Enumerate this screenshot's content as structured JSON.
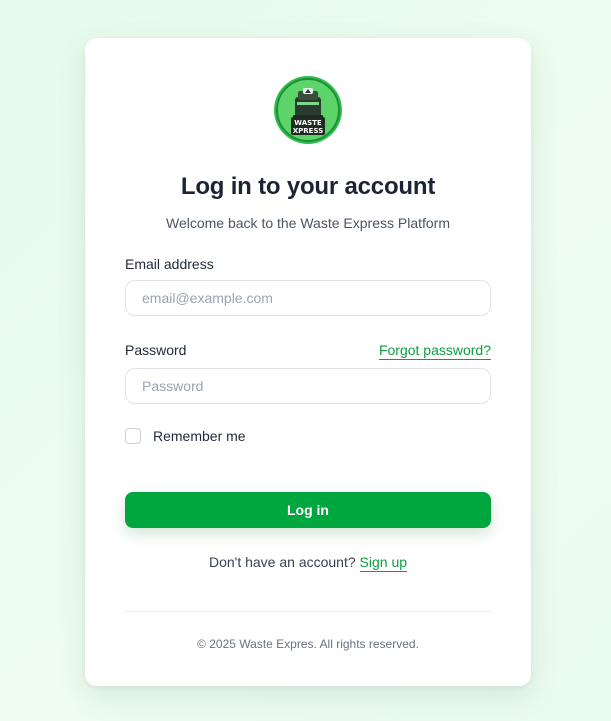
{
  "brand": {
    "logo_text_line1": "WASTE",
    "logo_text_line2": "XPRESS",
    "accent_color": "#00a63e"
  },
  "header": {
    "title": "Log in to your account",
    "subtitle": "Welcome back to the Waste Express Platform"
  },
  "form": {
    "email_label": "Email address",
    "email_placeholder": "email@example.com",
    "email_value": "",
    "password_label": "Password",
    "password_placeholder": "Password",
    "password_value": "",
    "forgot_link": "Forgot password?",
    "remember_label": "Remember me",
    "remember_checked": false,
    "submit_label": "Log in"
  },
  "signup": {
    "prompt": "Don't have an account?",
    "link": "Sign up"
  },
  "footer": {
    "copyright": "© 2025 Waste Expres. All rights reserved."
  },
  "icons": {
    "logo": "waste-express-truck-logo-icon"
  }
}
